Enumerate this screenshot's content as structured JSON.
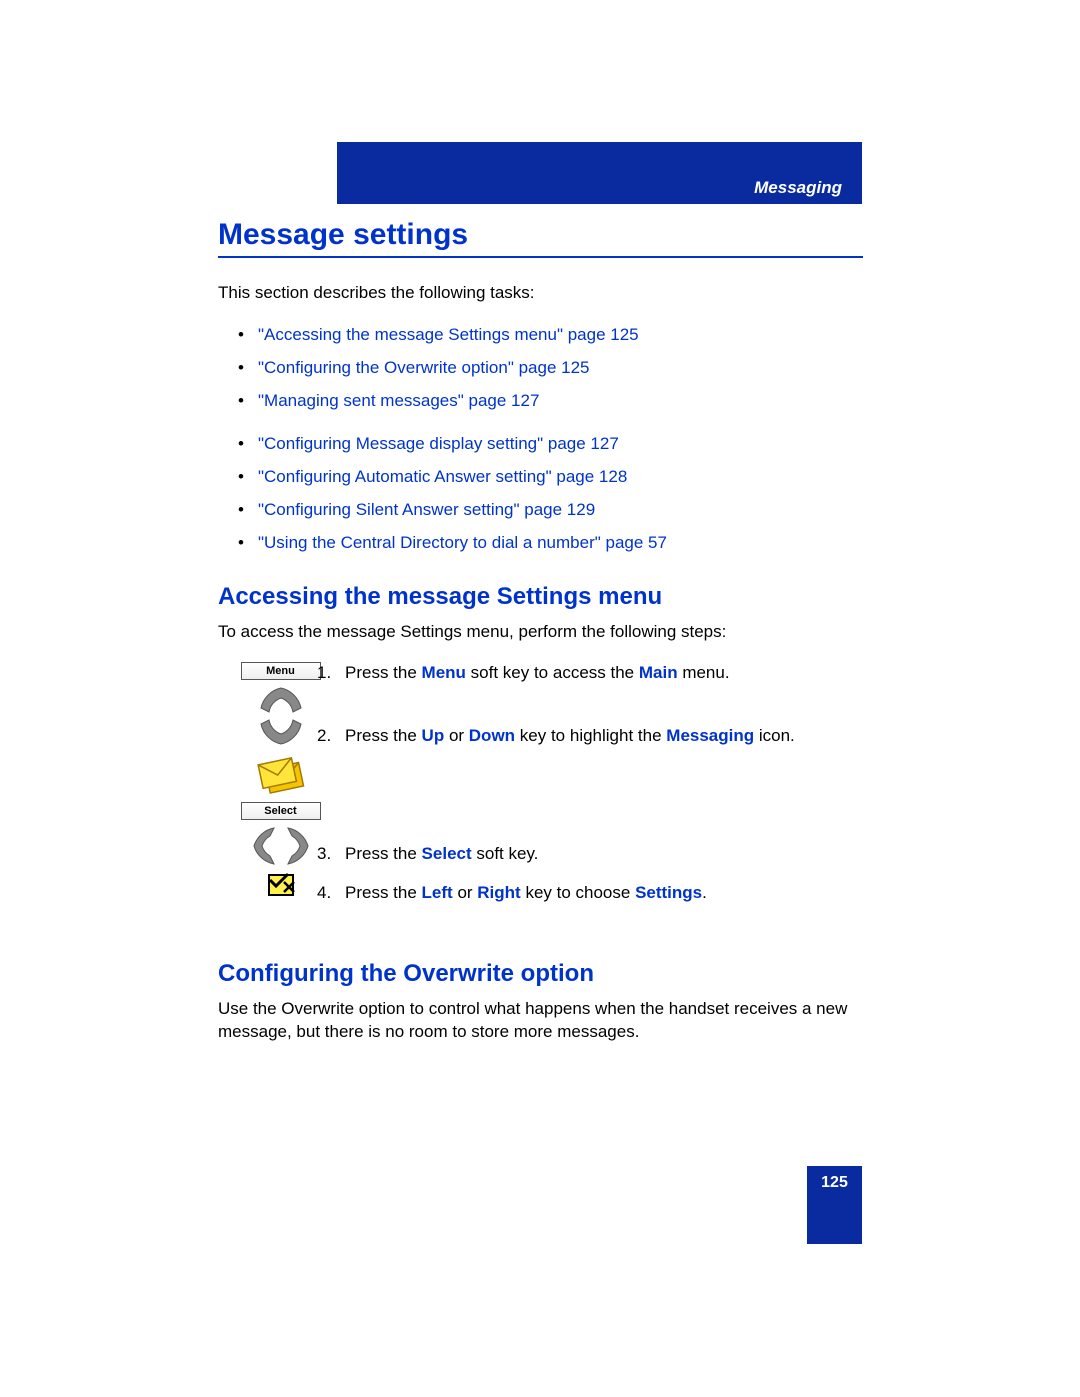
{
  "header": {
    "section": "Messaging"
  },
  "title": "Message settings",
  "intro": "This section describes the following tasks:",
  "toc": [
    "\"Accessing the message Settings menu\" page 125",
    "\"Configuring the Overwrite option\" page 125",
    "\"Managing sent messages\" page 127",
    "\"Configuring Message display setting\" page 127",
    "\"Configuring Automatic Answer setting\" page 128",
    "\"Configuring Silent Answer setting\" page 129",
    "\"Using the Central Directory to dial a number\" page 57"
  ],
  "section1": {
    "heading": "Accessing the message Settings menu",
    "intro": "To access the message Settings menu, perform the following steps:",
    "softkey_menu": "Menu",
    "softkey_select": "Select",
    "steps": {
      "s1a": "Press the ",
      "s1b": "Menu",
      "s1c": " soft key to access the ",
      "s1d": "Main",
      "s1e": " menu.",
      "s2a": "Press the ",
      "s2b": "Up",
      "s2c": " or ",
      "s2d": "Down",
      "s2e": " key to highlight the ",
      "s2f": "Messaging",
      "s2g": " icon.",
      "s3a": "Press the ",
      "s3b": "Select",
      "s3c": " soft key.",
      "s4a": "Press the ",
      "s4b": "Left",
      "s4c": " or ",
      "s4d": "Right",
      "s4e": " key to choose ",
      "s4f": "Settings",
      "s4g": "."
    }
  },
  "section2": {
    "heading": "Configuring the Overwrite option",
    "body": "Use the Overwrite option to control what happens when the handset receives a new message, but there is no room to store more messages."
  },
  "page_number": "125"
}
